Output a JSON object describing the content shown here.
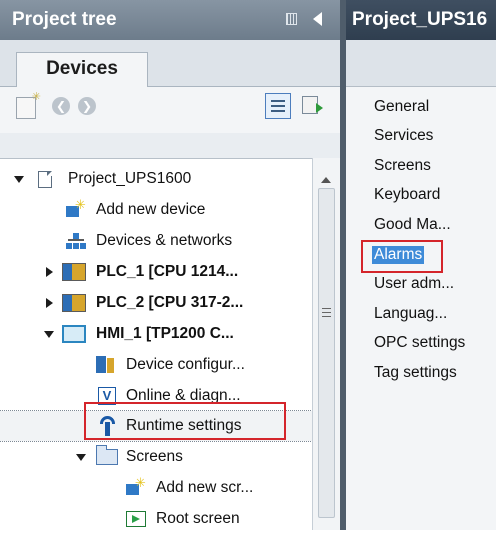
{
  "project_tree": {
    "title": "Project tree",
    "header_icons": [
      "pane-layout-icon",
      "collapse-left-icon"
    ],
    "tab_label": "Devices",
    "toolbar_icons": [
      "new-folder-icon",
      "back-icon",
      "forward-icon",
      "details-view-icon",
      "export-icon"
    ],
    "items": [
      {
        "label": "Project_UPS1600",
        "icon": "project-icon",
        "expanded": true
      },
      {
        "label": "Add new device",
        "icon": "add-device-icon"
      },
      {
        "label": "Devices & networks",
        "icon": "network-icon"
      },
      {
        "label": "PLC_1 [CPU 1214...",
        "icon": "plc-icon",
        "expanded": false
      },
      {
        "label": "PLC_2 [CPU 317-2...",
        "icon": "plc-icon",
        "expanded": false
      },
      {
        "label": "HMI_1 [TP1200 C...",
        "icon": "hmi-icon",
        "expanded": true
      },
      {
        "label": "Device configur...",
        "icon": "device-config-icon"
      },
      {
        "label": "Online & diagn...",
        "icon": "online-diagnostics-icon"
      },
      {
        "label": "Runtime settings",
        "icon": "wrench-icon",
        "selected": true,
        "highlight_color": "#d4252b"
      },
      {
        "label": "Screens",
        "icon": "folder-icon",
        "expanded": true
      },
      {
        "label": "Add new scr...",
        "icon": "add-screen-icon"
      },
      {
        "label": "Root screen",
        "icon": "screen-icon"
      }
    ]
  },
  "editor": {
    "title": "Project_UPS16",
    "nav_items": [
      {
        "label": "General"
      },
      {
        "label": "Services"
      },
      {
        "label": "Screens"
      },
      {
        "label": "Keyboard"
      },
      {
        "label": "Good Ma..."
      },
      {
        "label": "Alarms",
        "selected": true,
        "highlight_color": "#d4252b"
      },
      {
        "label": "User adm..."
      },
      {
        "label": "Languag..."
      },
      {
        "label": "OPC settings"
      },
      {
        "label": "Tag settings"
      }
    ]
  },
  "colors": {
    "header_bg": "#6d7c8b",
    "editor_header_bg": "#2f3e4f",
    "selection_blue": "#3e8bd8",
    "annotation_red": "#d4252b"
  }
}
